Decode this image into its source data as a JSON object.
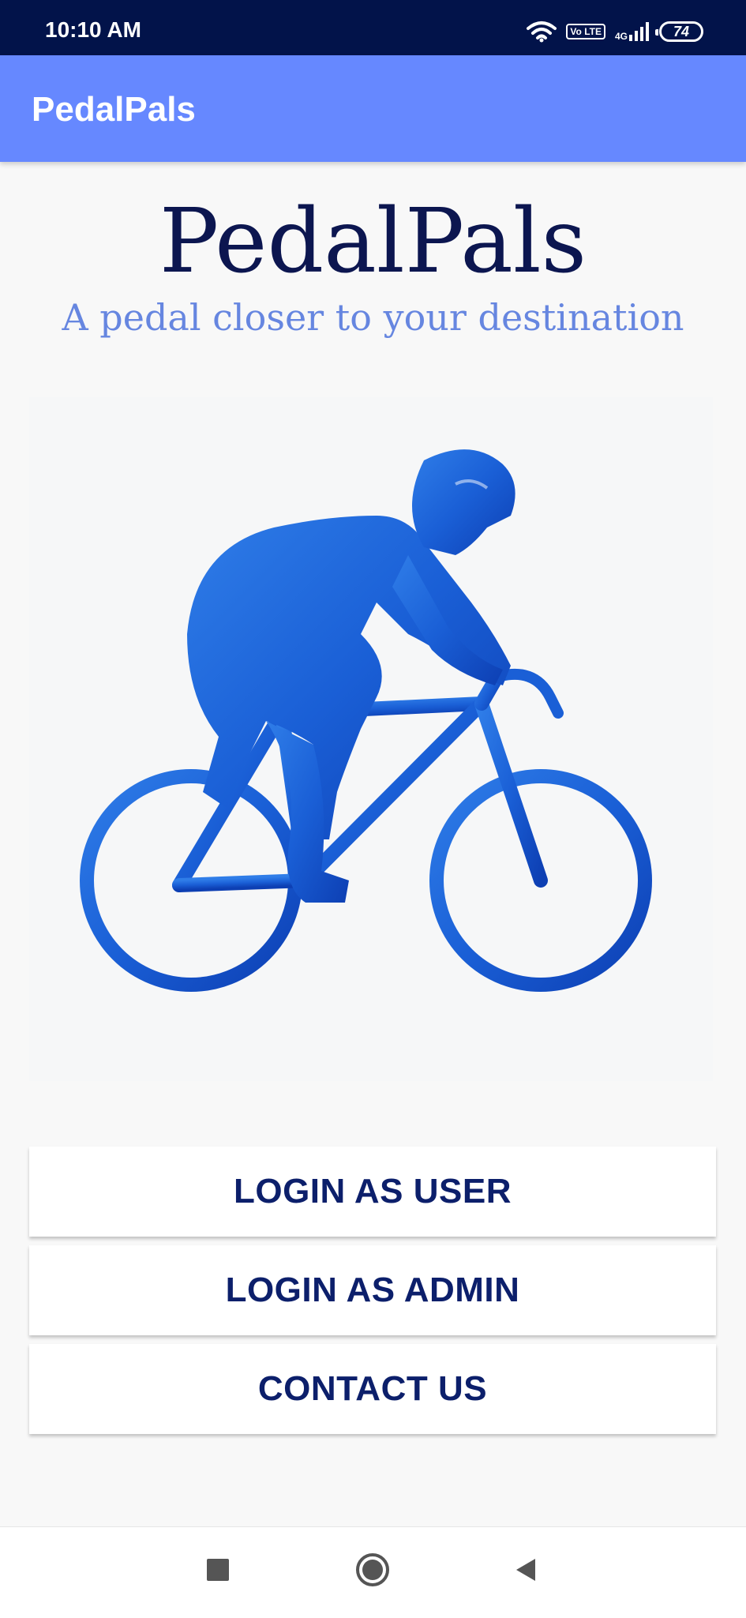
{
  "status_bar": {
    "time": "10:10 AM",
    "network_label": "4G",
    "volte_label": "Vo LTE",
    "battery": "74"
  },
  "app_bar": {
    "title": "PedalPals"
  },
  "hero": {
    "title": "PedalPals",
    "subtitle": "A pedal closer to your destination"
  },
  "illustration": {
    "icon": "cyclist-icon",
    "colors": [
      "#1a5fd6",
      "#2f7de8",
      "#0d3fb3"
    ]
  },
  "actions": {
    "login_user": "LOGIN AS USER",
    "login_admin": "LOGIN AS ADMIN",
    "contact_us": "CONTACT US"
  },
  "nav_bar": {
    "icons": [
      "recents-icon",
      "home-icon",
      "back-icon"
    ]
  },
  "colors": {
    "status_bar": "#02134a",
    "app_bar": "#6688ff",
    "title": "#0c1650",
    "subtitle": "#6686e0",
    "button_text": "#0c1f6b"
  }
}
